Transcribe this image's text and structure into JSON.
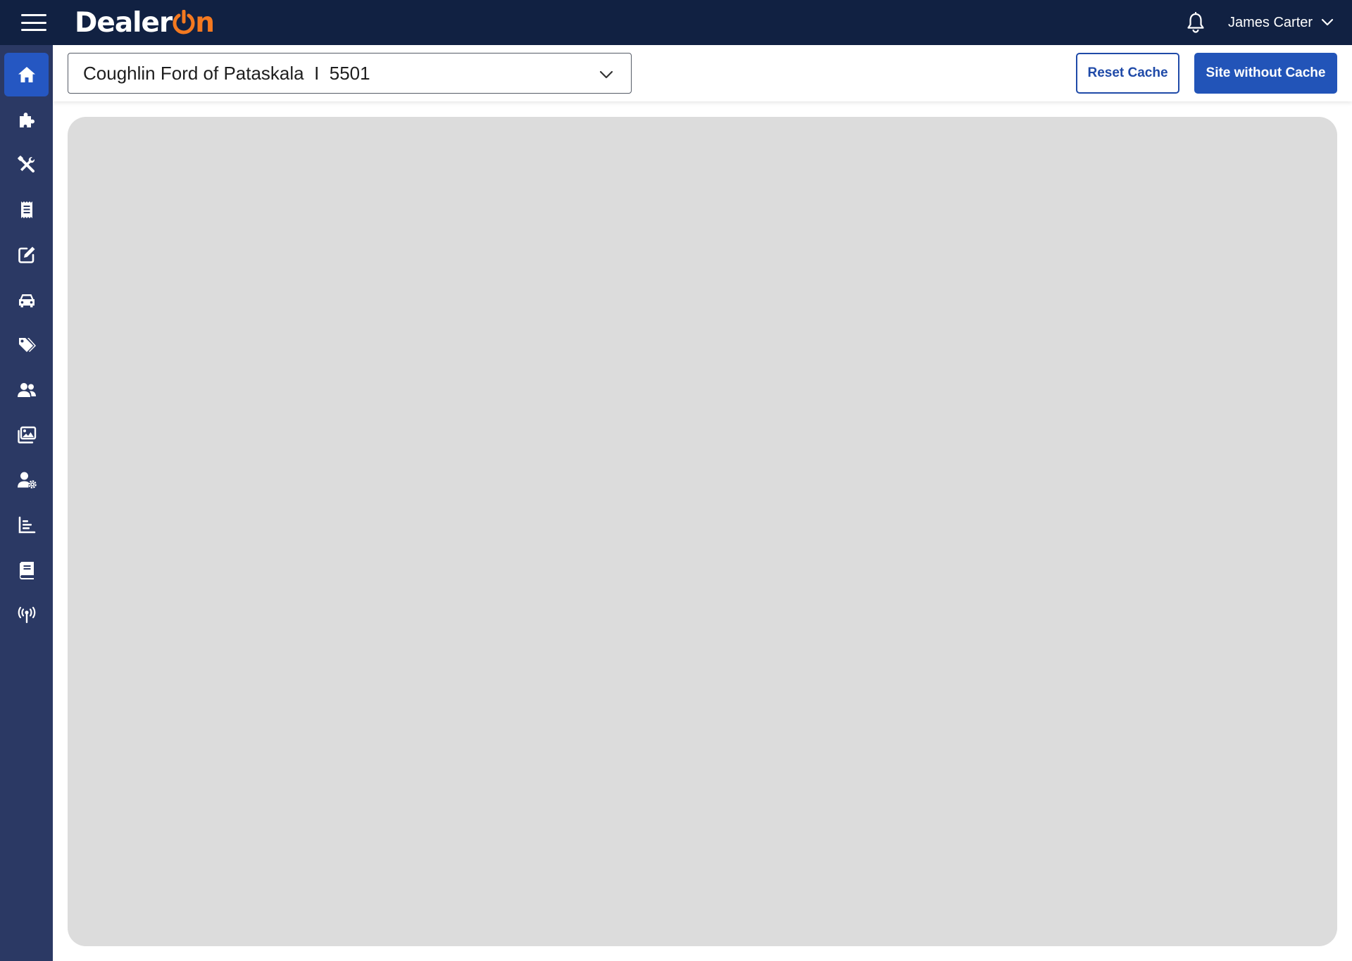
{
  "app": {
    "logo_text": "Dealer",
    "logo_suffix": "n",
    "brand_color": "#f47920",
    "topbar_color": "#112142"
  },
  "topbar": {
    "menu_icon": "hamburger-icon",
    "notifications_icon": "bell-icon",
    "user_name": "James Carter",
    "user_menu_icon": "chevron-down-icon"
  },
  "sidebar": {
    "items": [
      {
        "icon": "home-icon",
        "active": true
      },
      {
        "icon": "puzzle-icon",
        "active": false
      },
      {
        "icon": "tools-icon",
        "active": false
      },
      {
        "icon": "receipt-icon",
        "active": false
      },
      {
        "icon": "edit-icon",
        "active": false
      },
      {
        "icon": "car-icon",
        "active": false
      },
      {
        "icon": "tags-icon",
        "active": false
      },
      {
        "icon": "users-icon",
        "active": false
      },
      {
        "icon": "images-icon",
        "active": false
      },
      {
        "icon": "user-settings-icon",
        "active": false
      },
      {
        "icon": "chart-icon",
        "active": false
      },
      {
        "icon": "book-icon",
        "active": false
      },
      {
        "icon": "antenna-icon",
        "active": false
      }
    ],
    "active_color": "#2557c2",
    "background": "#2b3964"
  },
  "toolbar": {
    "site_selector_value": "Coughlin Ford of Pataskala  I  5501",
    "reset_cache_label": "Reset Cache",
    "site_without_cache_label": "Site without Cache",
    "accent_color": "#2254b8"
  }
}
